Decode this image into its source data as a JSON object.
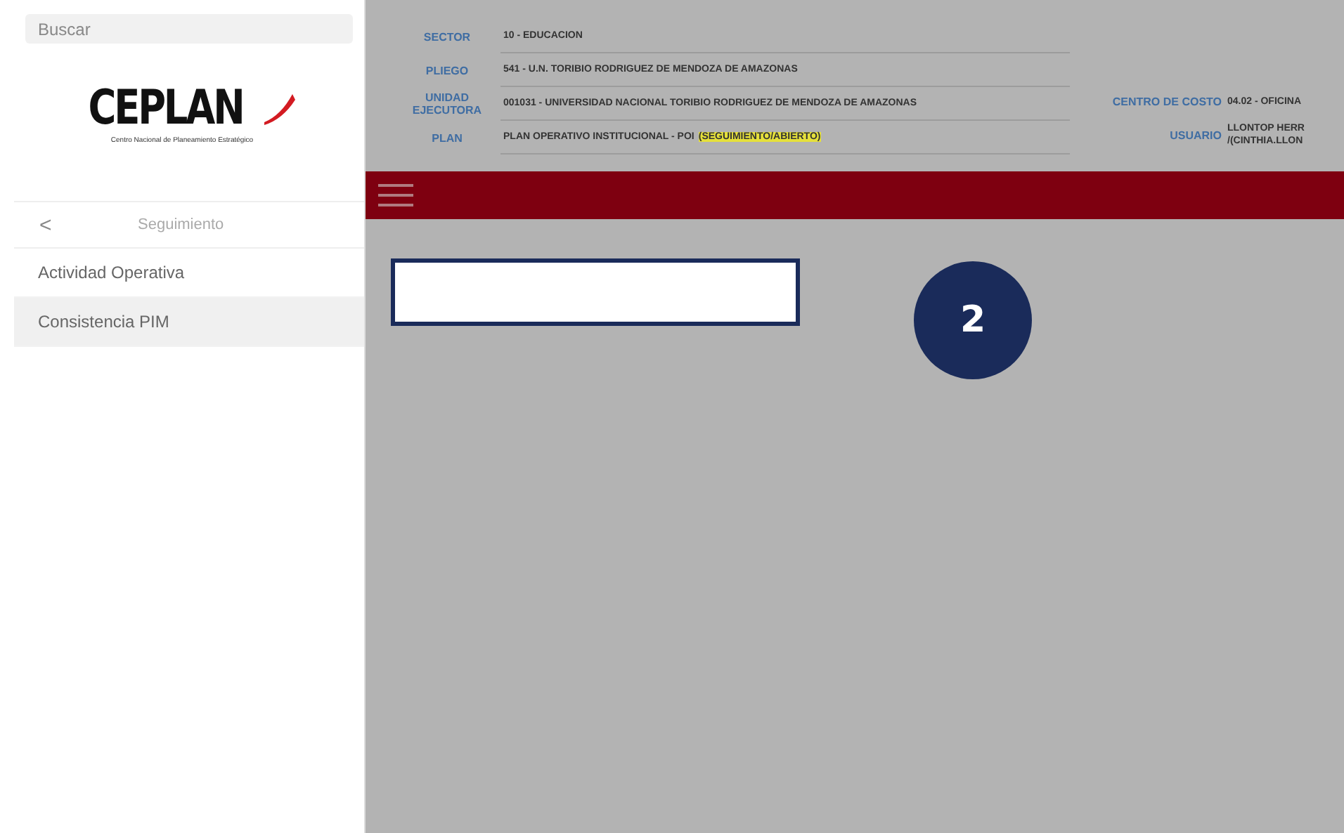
{
  "sidebar": {
    "search": {
      "placeholder": "Buscar"
    },
    "logo": {
      "name": "CEPLAN",
      "tagline": "Centro Nacional de Planeamiento Estratégico"
    },
    "nav": {
      "back": "<",
      "title": "Seguimiento"
    },
    "items": [
      {
        "label": "Actividad Operativa",
        "selected": false
      },
      {
        "label": "Consistencia PIM",
        "selected": true
      }
    ]
  },
  "header": {
    "fields": [
      {
        "label": "SECTOR",
        "value": "10 - EDUCACION"
      },
      {
        "label": "PLIEGO",
        "value": "541 - U.N. TORIBIO RODRIGUEZ DE MENDOZA DE AMAZONAS"
      },
      {
        "label": "UNIDAD EJECUTORA",
        "value": "001031 - UNIVERSIDAD NACIONAL TORIBIO RODRIGUEZ DE MENDOZA DE AMAZONAS"
      },
      {
        "label": "PLAN",
        "value": "PLAN OPERATIVO INSTITUCIONAL - POI",
        "status": "(SEGUIMIENTO/ABIERTO)"
      }
    ],
    "side_fields": [
      {
        "label": "CENTRO DE COSTO",
        "value": [
          "04.02 - OFICINA"
        ]
      },
      {
        "label": "USUARIO",
        "value": [
          "LLONTOP HERR",
          "/(CINTHIA.LLON"
        ]
      }
    ]
  },
  "step": {
    "number": "2"
  }
}
